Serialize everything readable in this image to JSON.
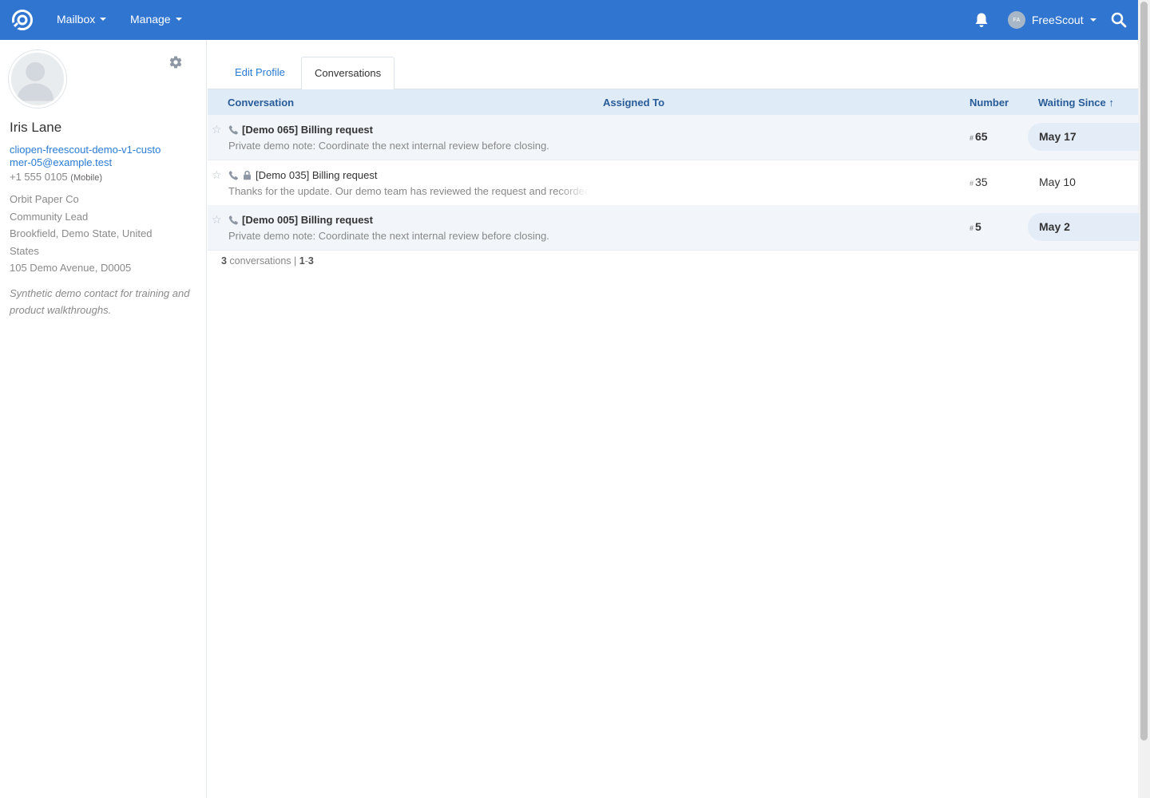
{
  "nav": {
    "mailbox_label": "Mailbox",
    "manage_label": "Manage",
    "user_initials": "FA",
    "user_name": "FreeScout",
    "brand_color": "#3075d0"
  },
  "customer": {
    "name": "Iris Lane",
    "email": "cliopen-freescout-demo-v1-customer-05@example.test",
    "phone": "+1 555 0105",
    "phone_type": "(Mobile)",
    "company": "Orbit Paper Co",
    "job_title": "Community Lead",
    "location": "Brookfield, Demo State, United States",
    "address": "105 Demo Avenue, D0005",
    "note": "Synthetic demo contact for training and product walkthroughs."
  },
  "tabs": {
    "edit_profile": "Edit Profile",
    "conversations": "Conversations"
  },
  "table": {
    "columns": {
      "conversation": "Conversation",
      "assigned_to": "Assigned To",
      "number": "Number",
      "waiting_since": "Waiting Since ↑"
    },
    "rows": [
      {
        "subject": "[Demo 065] Billing request",
        "preview": "Private demo note: Coordinate the next internal review before closing.",
        "number": "65",
        "waiting_since": "May 17",
        "unread": true,
        "locked": false
      },
      {
        "subject": "[Demo 035] Billing request",
        "preview": "Thanks for the update. Our demo team has reviewed the request and recorded the next steps.",
        "number": "35",
        "waiting_since": "May 10",
        "unread": false,
        "locked": true
      },
      {
        "subject": "[Demo 005] Billing request",
        "preview": "Private demo note: Coordinate the next internal review before closing.",
        "number": "5",
        "waiting_since": "May 2",
        "unread": true,
        "locked": false
      }
    ]
  },
  "pager": {
    "count": "3",
    "count_label": " conversations",
    "separator": " |  ",
    "range_start": "1",
    "range_dash": "-",
    "range_end": "3"
  },
  "number_prefix": "#",
  "star_glyph": "☆"
}
